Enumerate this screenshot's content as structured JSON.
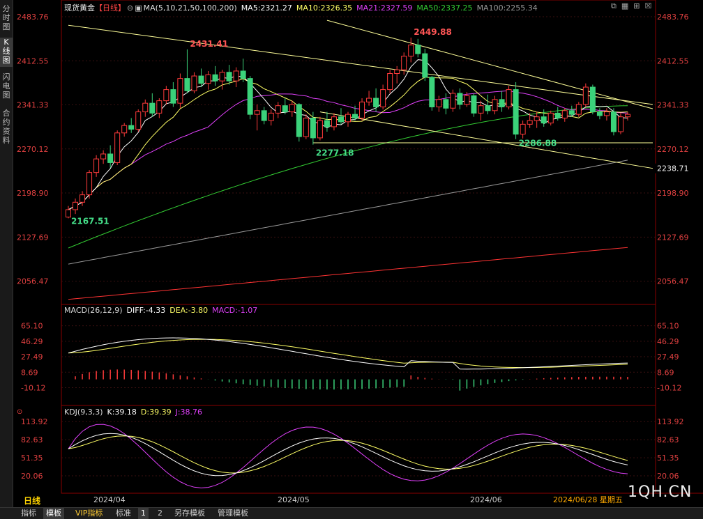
{
  "left_tabs": [
    {
      "label": "分\n时\n图",
      "active": false
    },
    {
      "label": "K\n线\n图",
      "active": true
    },
    {
      "label": "闪\n电\n图",
      "active": false
    },
    {
      "label": "合\n约\n资\n料",
      "active": false
    }
  ],
  "header": {
    "instrument": "现货黄金",
    "period": "【日线】",
    "ma_label": "MA(5,10,21,50,100,200)",
    "ma5": "MA5:2321.27",
    "ma10": "MA10:2326.35",
    "ma21": "MA21:2327.59",
    "ma50": "MA50:2337.25",
    "ma100": "MA100:2255.34"
  },
  "macd_header": {
    "label": "MACD(26,12,9)",
    "diff": "DIFF:-4.33",
    "dea": "DEA:-3.80",
    "macd": "MACD:-1.07"
  },
  "kdj_header": {
    "label": "KDJ(9,3,3)",
    "k": "K:39.18",
    "d": "D:39.39",
    "j": "J:38.76"
  },
  "annotations": {
    "high1": "2431.41",
    "high2": "2449.88",
    "low1": "2167.51",
    "low2": "2277.18",
    "low3": "2286.88",
    "trend_value": "2238.71"
  },
  "x_axis": [
    "2024/04",
    "2024/05",
    "2024/06"
  ],
  "date_readout": "2024/06/28 星期五",
  "period_label": "日线",
  "watermark": "1QH.CN",
  "bottom_tabs": [
    {
      "label": "指标",
      "active": false
    },
    {
      "label": "模板",
      "active": true
    },
    {
      "label": "VIP指标",
      "active": false
    },
    {
      "label": "标准",
      "active": false
    },
    {
      "label": "1",
      "active": true
    },
    {
      "label": "2",
      "active": false
    },
    {
      "label": "另存模板",
      "active": false
    },
    {
      "label": "管理模板",
      "active": false
    }
  ],
  "colors": {
    "up": "#ff3b3b",
    "down": "#3bd27a",
    "ma5": "#ffffff",
    "ma10": "#ffff66",
    "ma21": "#e040fb",
    "ma50": "#33cc33",
    "ma100": "#999999",
    "ma200": "#ff3333"
  },
  "chart_data": [
    {
      "type": "candlestick",
      "title": "现货黄金【日线】",
      "y_ticks": [
        2483.76,
        2412.55,
        2341.33,
        2270.12,
        2198.9,
        2127.69,
        2056.47
      ],
      "ylim": [
        2020,
        2495
      ],
      "x_ticks": [
        "2024/04",
        "2024/05",
        "2024/06"
      ],
      "candles": [
        [
          2160,
          2178,
          2158,
          2172
        ],
        [
          2172,
          2190,
          2165,
          2184
        ],
        [
          2184,
          2202,
          2178,
          2196
        ],
        [
          2196,
          2236,
          2190,
          2232
        ],
        [
          2232,
          2260,
          2225,
          2254
        ],
        [
          2254,
          2268,
          2246,
          2262
        ],
        [
          2262,
          2276,
          2240,
          2248
        ],
        [
          2248,
          2300,
          2244,
          2296
        ],
        [
          2296,
          2312,
          2290,
          2308
        ],
        [
          2308,
          2320,
          2296,
          2302
        ],
        [
          2302,
          2334,
          2298,
          2330
        ],
        [
          2330,
          2350,
          2322,
          2344
        ],
        [
          2344,
          2360,
          2322,
          2328
        ],
        [
          2328,
          2352,
          2320,
          2348
        ],
        [
          2348,
          2372,
          2342,
          2366
        ],
        [
          2366,
          2378,
          2338,
          2344
        ],
        [
          2344,
          2392,
          2336,
          2384
        ],
        [
          2384,
          2431,
          2360,
          2364
        ],
        [
          2364,
          2394,
          2360,
          2388
        ],
        [
          2388,
          2400,
          2370,
          2376
        ],
        [
          2376,
          2396,
          2366,
          2390
        ],
        [
          2390,
          2404,
          2372,
          2380
        ],
        [
          2380,
          2398,
          2366,
          2394
        ],
        [
          2394,
          2406,
          2374,
          2380
        ],
        [
          2380,
          2402,
          2370,
          2396
        ],
        [
          2396,
          2416,
          2378,
          2384
        ],
        [
          2384,
          2388,
          2318,
          2326
        ],
        [
          2326,
          2342,
          2300,
          2332
        ],
        [
          2332,
          2338,
          2310,
          2316
        ],
        [
          2316,
          2334,
          2308,
          2328
        ],
        [
          2328,
          2346,
          2320,
          2340
        ],
        [
          2340,
          2352,
          2326,
          2330
        ],
        [
          2330,
          2348,
          2322,
          2342
        ],
        [
          2342,
          2344,
          2282,
          2290
        ],
        [
          2290,
          2326,
          2286,
          2320
        ],
        [
          2320,
          2330,
          2277,
          2288
        ],
        [
          2288,
          2322,
          2284,
          2316
        ],
        [
          2316,
          2330,
          2298,
          2306
        ],
        [
          2306,
          2328,
          2300,
          2322
        ],
        [
          2322,
          2336,
          2310,
          2314
        ],
        [
          2314,
          2330,
          2306,
          2326
        ],
        [
          2326,
          2340,
          2316,
          2320
        ],
        [
          2320,
          2352,
          2316,
          2346
        ],
        [
          2346,
          2364,
          2340,
          2352
        ],
        [
          2352,
          2368,
          2330,
          2338
        ],
        [
          2338,
          2374,
          2334,
          2366
        ],
        [
          2366,
          2398,
          2360,
          2392
        ],
        [
          2392,
          2404,
          2376,
          2398
        ],
        [
          2398,
          2426,
          2390,
          2420
        ],
        [
          2420,
          2450,
          2410,
          2438
        ],
        [
          2438,
          2448,
          2418,
          2424
        ],
        [
          2424,
          2432,
          2380,
          2386
        ],
        [
          2386,
          2388,
          2332,
          2338
        ],
        [
          2338,
          2356,
          2330,
          2350
        ],
        [
          2350,
          2360,
          2326,
          2336
        ],
        [
          2336,
          2366,
          2330,
          2360
        ],
        [
          2360,
          2368,
          2334,
          2342
        ],
        [
          2342,
          2362,
          2338,
          2356
        ],
        [
          2356,
          2360,
          2322,
          2328
        ],
        [
          2328,
          2348,
          2316,
          2340
        ],
        [
          2340,
          2358,
          2326,
          2332
        ],
        [
          2332,
          2356,
          2326,
          2350
        ],
        [
          2350,
          2364,
          2330,
          2338
        ],
        [
          2338,
          2372,
          2334,
          2366
        ],
        [
          2366,
          2378,
          2286,
          2294
        ],
        [
          2294,
          2316,
          2287,
          2310
        ],
        [
          2310,
          2328,
          2304,
          2316
        ],
        [
          2316,
          2330,
          2304,
          2322
        ],
        [
          2322,
          2334,
          2306,
          2312
        ],
        [
          2312,
          2332,
          2308,
          2328
        ],
        [
          2328,
          2338,
          2316,
          2320
        ],
        [
          2320,
          2336,
          2314,
          2332
        ],
        [
          2332,
          2340,
          2322,
          2326
        ],
        [
          2326,
          2346,
          2322,
          2342
        ],
        [
          2342,
          2376,
          2338,
          2370
        ],
        [
          2370,
          2374,
          2326,
          2330
        ],
        [
          2330,
          2336,
          2318,
          2324
        ],
        [
          2324,
          2336,
          2316,
          2330
        ],
        [
          2330,
          2336,
          2292,
          2298
        ],
        [
          2298,
          2328,
          2294,
          2322
        ],
        [
          2322,
          2330,
          2316,
          2326
        ]
      ],
      "ma_series": [
        {
          "name": "MA5"
        },
        {
          "name": "MA10"
        },
        {
          "name": "MA21"
        },
        {
          "name": "MA50"
        },
        {
          "name": "MA100"
        },
        {
          "name": "MA200"
        }
      ]
    },
    {
      "type": "bar",
      "title": "MACD(26,12,9)",
      "y_ticks": [
        65.1,
        46.29,
        27.49,
        8.69,
        -10.12
      ],
      "ylim": [
        -30,
        80
      ]
    },
    {
      "type": "line",
      "title": "KDJ(9,3,3)",
      "y_ticks": [
        113.92,
        82.63,
        51.35,
        20.06
      ],
      "ylim": [
        -10,
        125
      ]
    }
  ]
}
